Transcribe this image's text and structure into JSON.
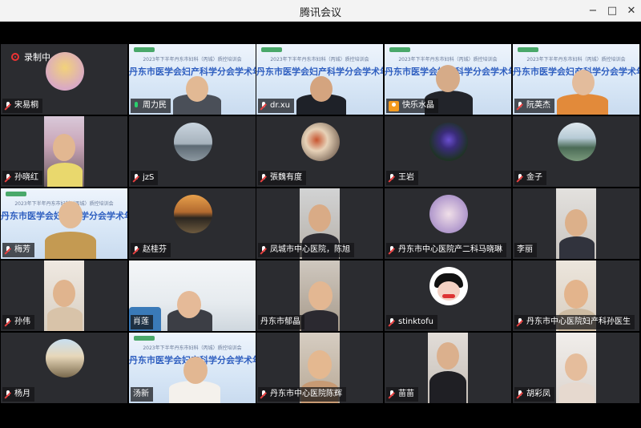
{
  "window": {
    "title": "腾讯会议",
    "minimize": "−",
    "maximize": "□",
    "close": "✕"
  },
  "recording": {
    "label": "录制中"
  },
  "banner_text": {
    "line1": "2023年下半年丹东市妇科（丙城）质控培训会",
    "line2": "丹东市医学会妇产科学分会学术年会"
  },
  "participants": [
    {
      "name": "宋易桐",
      "mic": "muted"
    },
    {
      "name": "周力民",
      "mic": "on"
    },
    {
      "name": "dr.xu",
      "mic": "muted"
    },
    {
      "name": "快乐水晶",
      "mic": "muted"
    },
    {
      "name": "阮英杰",
      "mic": "muted"
    },
    {
      "name": "孙晓红",
      "mic": "muted"
    },
    {
      "name": "jzS",
      "mic": "muted"
    },
    {
      "name": "張魏有度",
      "mic": "muted"
    },
    {
      "name": "王岩",
      "mic": "muted"
    },
    {
      "name": "金子",
      "mic": "muted"
    },
    {
      "name": "梅芳",
      "mic": "muted"
    },
    {
      "name": "赵桂芬",
      "mic": "muted"
    },
    {
      "name": "凤城市中心医院，陈旭",
      "mic": "muted"
    },
    {
      "name": "丹东市中心医院产二科马晓琳",
      "mic": "muted"
    },
    {
      "name": "李丽",
      "mic": "none"
    },
    {
      "name": "孙伟",
      "mic": "muted"
    },
    {
      "name": "肖莲",
      "mic": "none"
    },
    {
      "name": "丹东市郁晶",
      "mic": "none"
    },
    {
      "name": "stinktofu",
      "mic": "muted"
    },
    {
      "name": "丹东市中心医院妇产科孙医生",
      "mic": "muted"
    },
    {
      "name": "杨月",
      "mic": "muted"
    },
    {
      "name": "汤新",
      "mic": "none"
    },
    {
      "name": "丹东市中心医院陈辉",
      "mic": "muted"
    },
    {
      "name": "苗苗",
      "mic": "muted"
    },
    {
      "name": "胡彩凤",
      "mic": "muted"
    }
  ],
  "colors": {
    "active_speaker": "#1fcf7a",
    "tile_bg": "#2b2c30"
  }
}
